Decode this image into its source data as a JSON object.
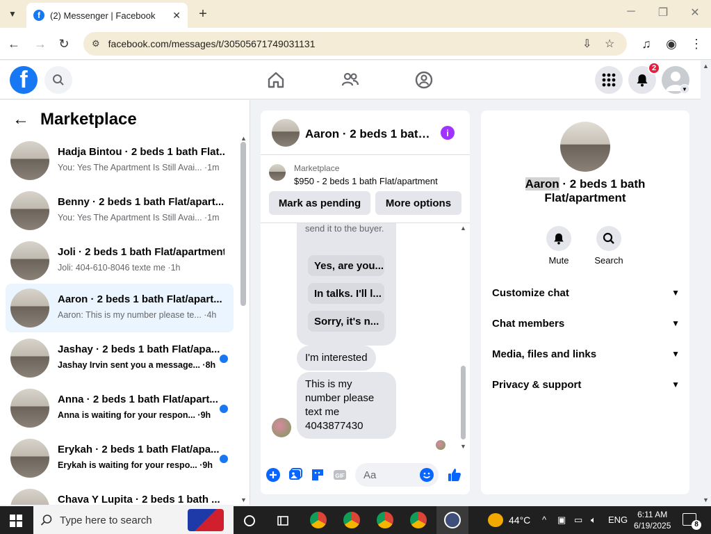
{
  "browser": {
    "tab_title": "(2) Messenger | Facebook",
    "url": "facebook.com/messages/t/30505671749031131",
    "new_tab_symbol": "+",
    "tab_close_symbol": "✕"
  },
  "fb_nav": {
    "notifications_count": "2",
    "logo_letter": "f"
  },
  "left_panel": {
    "back_symbol": "←",
    "title": "Marketplace",
    "conversations": [
      {
        "name": "Hadja Bintou · 2 beds 1 bath Flat/apartment",
        "preview": "You: Yes The Apartment Is Still Available",
        "time": "1m",
        "unread": false
      },
      {
        "name": "Benny · 2 beds 1 bath Flat/apartment",
        "preview": "You: Yes The Apartment Is Still Available",
        "time": "1m",
        "unread": false
      },
      {
        "name": "Joli · 2 beds 1 bath Flat/apartment",
        "preview": "Joli: 404-610-8046 texte me",
        "time": "1h",
        "unread": false
      },
      {
        "name": "Aaron · 2 beds 1 bath Flat/apartment",
        "preview": "Aaron: This is my number please text me",
        "time": "4h",
        "unread": false
      },
      {
        "name": "Jashay · 2 beds 1 bath Flat/apartment",
        "preview": "Jashay Irvin sent you a message.",
        "time": "8h",
        "unread": true
      },
      {
        "name": "Anna · 2 beds 1 bath Flat/apartment",
        "preview": "Anna is waiting for your response",
        "time": "9h",
        "unread": true
      },
      {
        "name": "Erykah · 2 beds 1 bath Flat/apartment",
        "preview": "Erykah is waiting for your response",
        "time": "9h",
        "unread": true
      },
      {
        "name": "Chava Y Lupita · 2 beds 1 bath Flat/apartment",
        "preview": "",
        "time": "",
        "unread": false
      }
    ],
    "display": [
      {
        "name": "Hadja Bintou · 2 beds 1 bath Flat...",
        "sub": "You: Yes The Apartment Is Still Avai... ·1m"
      },
      {
        "name": "Benny · 2 beds 1 bath Flat/apart...",
        "sub": "You: Yes The Apartment Is Still Avai... ·1m"
      },
      {
        "name": "Joli · 2 beds 1 bath Flat/apartment",
        "sub": "Joli: 404-610-8046 texte me ·1h"
      },
      {
        "name": "Aaron · 2 beds 1 bath Flat/apart...",
        "sub": "Aaron: This is my number please te... ·4h"
      },
      {
        "name": "Jashay · 2 beds 1 bath Flat/apa...",
        "sub": "Jashay Irvin sent you a message... ·8h"
      },
      {
        "name": "Anna · 2 beds 1 bath Flat/apart...",
        "sub": "Anna is waiting for your respon... ·9h"
      },
      {
        "name": "Erykah · 2 beds 1 bath Flat/apa...",
        "sub": "Erykah is waiting for your respo... ·9h"
      },
      {
        "name": "Chava Y Lupita · 2 beds 1 bath ...",
        "sub": ""
      }
    ]
  },
  "chat": {
    "header_name": "Aaron · 2 beds 1 bath Flat/apartment",
    "info_symbol": "i",
    "marketplace_label": "Marketplace",
    "listing": "$950 - 2 beds 1 bath Flat/apartment",
    "mark_pending_label": "Mark as pending",
    "more_options_label": "More options",
    "system_text": "send it to the buyer.",
    "quick_replies": [
      "Yes, are you...",
      "In talks. I'll l...",
      "Sorry, it's n..."
    ],
    "messages": [
      "I'm interested",
      "This is my number please text me 4043877430"
    ],
    "composer_placeholder": "Aa"
  },
  "info_panel": {
    "title_highlight": "Aaron",
    "title_rest": " · 2 beds 1 bath Flat/apartment",
    "mute_label": "Mute",
    "search_label": "Search",
    "sections": [
      "Customize chat",
      "Chat members",
      "Media, files and links",
      "Privacy & support"
    ]
  },
  "taskbar": {
    "search_placeholder": "Type here to search",
    "weather": "44°C",
    "language": "ENG",
    "time": "6:11 AM",
    "date": "6/19/2025",
    "notification_count": "8"
  },
  "colors": {
    "brand": "#1877f2",
    "info_purple": "#a033ff",
    "badge_red": "#e41e3f",
    "active_row": "#ebf5ff"
  }
}
